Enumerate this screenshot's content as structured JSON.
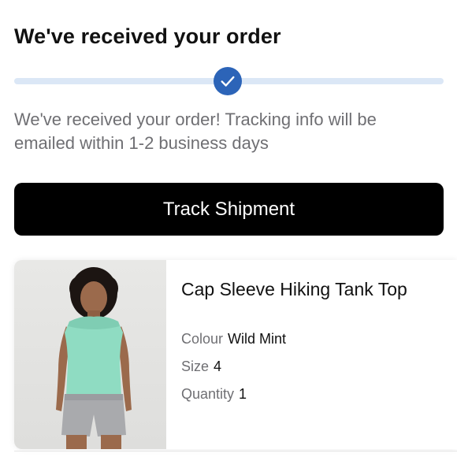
{
  "header": {
    "title": "We've received your order"
  },
  "progress": {
    "value": 0.5,
    "marker_icon": "checkmark-icon",
    "accent_color": "#2c64b8",
    "track_color": "#dbe7f6"
  },
  "message": {
    "text": "We've received your order! Tracking info will be emailed within 1-2 business days"
  },
  "actions": {
    "track_label": "Track Shipment"
  },
  "product": {
    "name": "Cap Sleeve Hiking Tank Top",
    "image_icon": "product-photo",
    "attributes": [
      {
        "label": "Colour",
        "value": "Wild Mint"
      },
      {
        "label": "Size",
        "value": "4"
      },
      {
        "label": "Quantity",
        "value": "1"
      }
    ]
  },
  "colors": {
    "button_bg": "#000000",
    "button_text": "#ffffff",
    "muted_text": "#6f6f73",
    "garment": "#8fdcc2"
  }
}
